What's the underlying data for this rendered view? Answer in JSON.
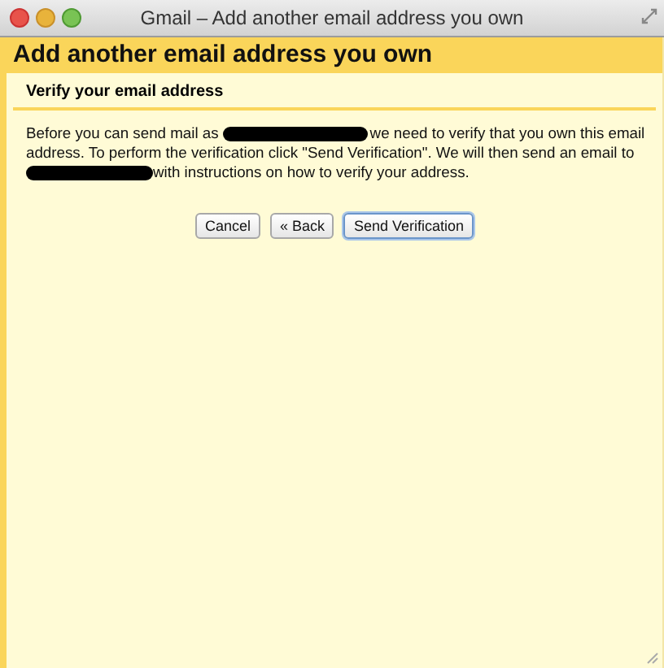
{
  "window": {
    "title": "Gmail – Add another email address you own"
  },
  "header": {
    "title": "Add another email address you own"
  },
  "section": {
    "title": "Verify your email address"
  },
  "paragraph": [
    [
      {
        "kind": "text",
        "text": "Before you can send mail as"
      },
      {
        "kind": "redacted"
      },
      {
        "kind": "text",
        "text": "we need to verify that you own this email"
      }
    ],
    [
      {
        "kind": "text",
        "text": "address. To perform the verification click \"Send Verification\". We will then send an email to"
      }
    ],
    [
      {
        "kind": "redacted"
      },
      {
        "kind": "text",
        "text": "with instructions on how to verify your address."
      }
    ]
  ],
  "buttons": [
    {
      "label": "Cancel",
      "default": false
    },
    {
      "label": "« Back",
      "default": false
    },
    {
      "label": "Send Verification",
      "default": true
    }
  ]
}
